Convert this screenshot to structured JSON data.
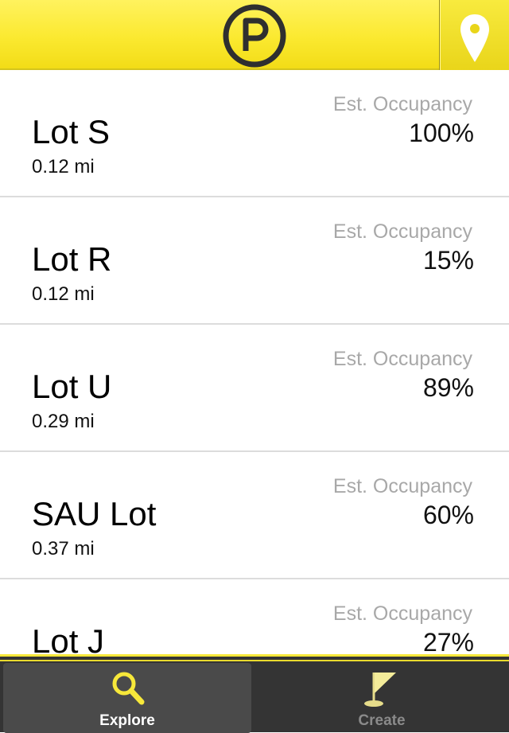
{
  "header": {
    "logo_icon": "parking-p-icon",
    "location_icon": "map-pin-icon",
    "accent_color": "#f7e83a"
  },
  "lots": [
    {
      "name": "Lot S",
      "distance": "0.12 mi",
      "occupancy_label": "Est. Occupancy",
      "occupancy": "100%"
    },
    {
      "name": "Lot R",
      "distance": "0.12 mi",
      "occupancy_label": "Est. Occupancy",
      "occupancy": "15%"
    },
    {
      "name": "Lot U",
      "distance": "0.29 mi",
      "occupancy_label": "Est. Occupancy",
      "occupancy": "89%"
    },
    {
      "name": "SAU Lot",
      "distance": "0.37 mi",
      "occupancy_label": "Est. Occupancy",
      "occupancy": "60%"
    },
    {
      "name": "Lot J",
      "distance": "",
      "occupancy_label": "Est. Occupancy",
      "occupancy": "27%"
    }
  ],
  "tabbar": {
    "tabs": [
      {
        "label": "Explore",
        "icon": "magnifier-icon",
        "selected": true
      },
      {
        "label": "Create",
        "icon": "flag-icon",
        "selected": false
      }
    ]
  }
}
